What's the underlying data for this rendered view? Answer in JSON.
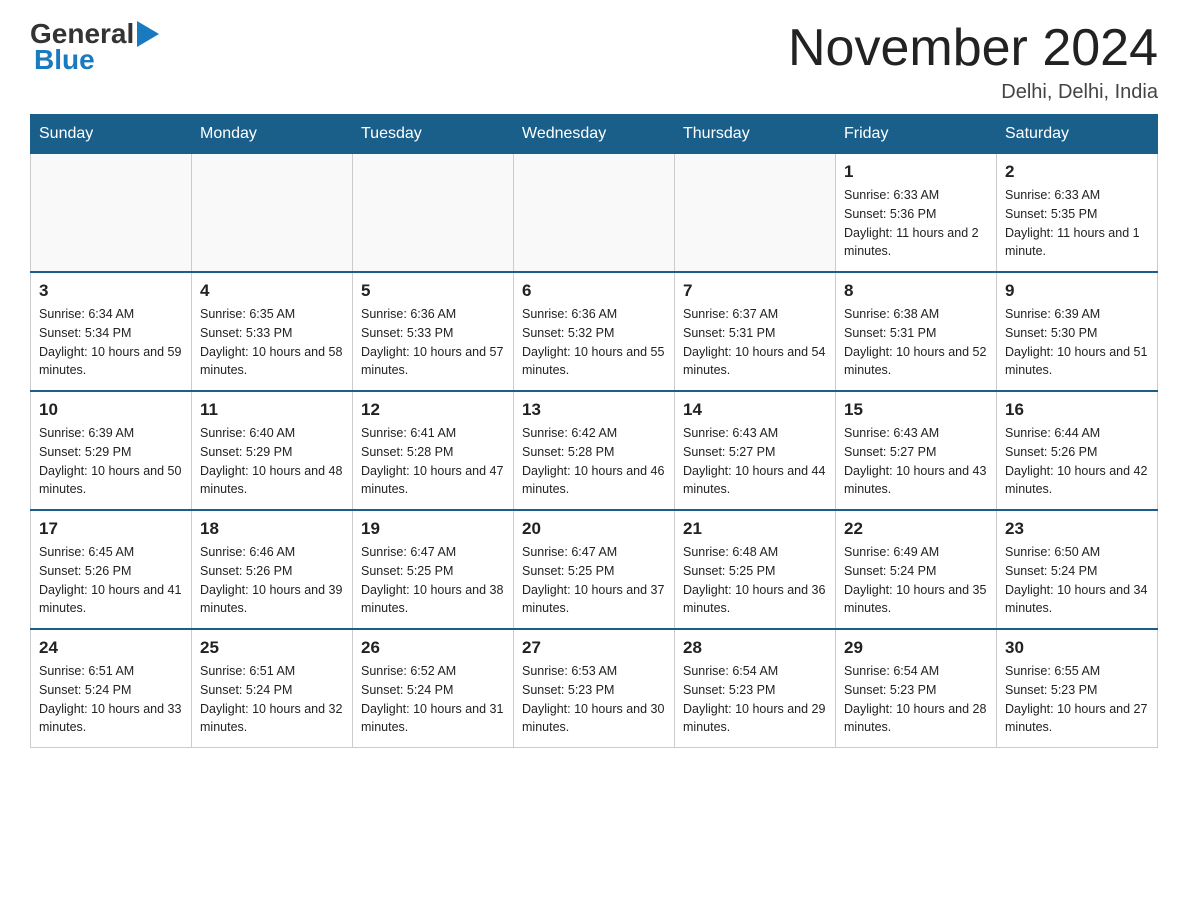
{
  "logo": {
    "general": "General",
    "blue": "Blue"
  },
  "title": "November 2024",
  "location": "Delhi, Delhi, India",
  "days_header": [
    "Sunday",
    "Monday",
    "Tuesday",
    "Wednesday",
    "Thursday",
    "Friday",
    "Saturday"
  ],
  "weeks": [
    {
      "days": [
        {
          "num": "",
          "info": ""
        },
        {
          "num": "",
          "info": ""
        },
        {
          "num": "",
          "info": ""
        },
        {
          "num": "",
          "info": ""
        },
        {
          "num": "",
          "info": ""
        },
        {
          "num": "1",
          "info": "Sunrise: 6:33 AM\nSunset: 5:36 PM\nDaylight: 11 hours and 2 minutes."
        },
        {
          "num": "2",
          "info": "Sunrise: 6:33 AM\nSunset: 5:35 PM\nDaylight: 11 hours and 1 minute."
        }
      ]
    },
    {
      "days": [
        {
          "num": "3",
          "info": "Sunrise: 6:34 AM\nSunset: 5:34 PM\nDaylight: 10 hours and 59 minutes."
        },
        {
          "num": "4",
          "info": "Sunrise: 6:35 AM\nSunset: 5:33 PM\nDaylight: 10 hours and 58 minutes."
        },
        {
          "num": "5",
          "info": "Sunrise: 6:36 AM\nSunset: 5:33 PM\nDaylight: 10 hours and 57 minutes."
        },
        {
          "num": "6",
          "info": "Sunrise: 6:36 AM\nSunset: 5:32 PM\nDaylight: 10 hours and 55 minutes."
        },
        {
          "num": "7",
          "info": "Sunrise: 6:37 AM\nSunset: 5:31 PM\nDaylight: 10 hours and 54 minutes."
        },
        {
          "num": "8",
          "info": "Sunrise: 6:38 AM\nSunset: 5:31 PM\nDaylight: 10 hours and 52 minutes."
        },
        {
          "num": "9",
          "info": "Sunrise: 6:39 AM\nSunset: 5:30 PM\nDaylight: 10 hours and 51 minutes."
        }
      ]
    },
    {
      "days": [
        {
          "num": "10",
          "info": "Sunrise: 6:39 AM\nSunset: 5:29 PM\nDaylight: 10 hours and 50 minutes."
        },
        {
          "num": "11",
          "info": "Sunrise: 6:40 AM\nSunset: 5:29 PM\nDaylight: 10 hours and 48 minutes."
        },
        {
          "num": "12",
          "info": "Sunrise: 6:41 AM\nSunset: 5:28 PM\nDaylight: 10 hours and 47 minutes."
        },
        {
          "num": "13",
          "info": "Sunrise: 6:42 AM\nSunset: 5:28 PM\nDaylight: 10 hours and 46 minutes."
        },
        {
          "num": "14",
          "info": "Sunrise: 6:43 AM\nSunset: 5:27 PM\nDaylight: 10 hours and 44 minutes."
        },
        {
          "num": "15",
          "info": "Sunrise: 6:43 AM\nSunset: 5:27 PM\nDaylight: 10 hours and 43 minutes."
        },
        {
          "num": "16",
          "info": "Sunrise: 6:44 AM\nSunset: 5:26 PM\nDaylight: 10 hours and 42 minutes."
        }
      ]
    },
    {
      "days": [
        {
          "num": "17",
          "info": "Sunrise: 6:45 AM\nSunset: 5:26 PM\nDaylight: 10 hours and 41 minutes."
        },
        {
          "num": "18",
          "info": "Sunrise: 6:46 AM\nSunset: 5:26 PM\nDaylight: 10 hours and 39 minutes."
        },
        {
          "num": "19",
          "info": "Sunrise: 6:47 AM\nSunset: 5:25 PM\nDaylight: 10 hours and 38 minutes."
        },
        {
          "num": "20",
          "info": "Sunrise: 6:47 AM\nSunset: 5:25 PM\nDaylight: 10 hours and 37 minutes."
        },
        {
          "num": "21",
          "info": "Sunrise: 6:48 AM\nSunset: 5:25 PM\nDaylight: 10 hours and 36 minutes."
        },
        {
          "num": "22",
          "info": "Sunrise: 6:49 AM\nSunset: 5:24 PM\nDaylight: 10 hours and 35 minutes."
        },
        {
          "num": "23",
          "info": "Sunrise: 6:50 AM\nSunset: 5:24 PM\nDaylight: 10 hours and 34 minutes."
        }
      ]
    },
    {
      "days": [
        {
          "num": "24",
          "info": "Sunrise: 6:51 AM\nSunset: 5:24 PM\nDaylight: 10 hours and 33 minutes."
        },
        {
          "num": "25",
          "info": "Sunrise: 6:51 AM\nSunset: 5:24 PM\nDaylight: 10 hours and 32 minutes."
        },
        {
          "num": "26",
          "info": "Sunrise: 6:52 AM\nSunset: 5:24 PM\nDaylight: 10 hours and 31 minutes."
        },
        {
          "num": "27",
          "info": "Sunrise: 6:53 AM\nSunset: 5:23 PM\nDaylight: 10 hours and 30 minutes."
        },
        {
          "num": "28",
          "info": "Sunrise: 6:54 AM\nSunset: 5:23 PM\nDaylight: 10 hours and 29 minutes."
        },
        {
          "num": "29",
          "info": "Sunrise: 6:54 AM\nSunset: 5:23 PM\nDaylight: 10 hours and 28 minutes."
        },
        {
          "num": "30",
          "info": "Sunrise: 6:55 AM\nSunset: 5:23 PM\nDaylight: 10 hours and 27 minutes."
        }
      ]
    }
  ]
}
